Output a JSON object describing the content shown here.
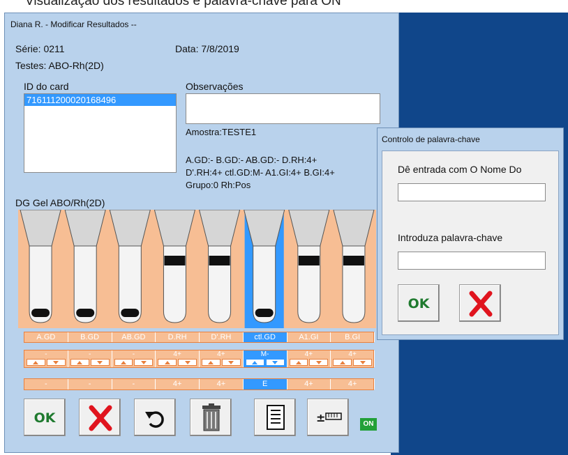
{
  "top_fragment": "Visualização dos resultados e palavra-chave para ON",
  "window": {
    "title": "Diana R. - Modificar Resultados --",
    "serie_label": "Série: 0211",
    "data_label": "Data: 7/8/2019",
    "testes_label": "Testes: ABO-Rh(2D)",
    "id_card_label": "ID do card",
    "id_card_items": [
      "716111200020168496"
    ],
    "observacoes_label": "Observações",
    "observacoes_value": "",
    "amostra": "Amostra:TESTE1",
    "result_line1": "A.GD:-  B.GD:-  AB.GD:-  D.RH:4+",
    "result_line2": "D'.RH:4+  ctl.GD:M-  A1.GI:4+  B.GI:4+",
    "result_line3": "Grupo:0  Rh:Pos",
    "gel_title": "DG Gel ABO/Rh(2D)"
  },
  "columns": [
    {
      "name": "A.GD",
      "reaction": "-",
      "final": "-",
      "selected": false,
      "band": "bottom"
    },
    {
      "name": "B.GD",
      "reaction": "-",
      "final": "-",
      "selected": false,
      "band": "bottom"
    },
    {
      "name": "AB.GD",
      "reaction": "-",
      "final": "-",
      "selected": false,
      "band": "bottom"
    },
    {
      "name": "D.RH",
      "reaction": "4+",
      "final": "4+",
      "selected": false,
      "band": "top"
    },
    {
      "name": "D'.RH",
      "reaction": "4+",
      "final": "4+",
      "selected": false,
      "band": "top"
    },
    {
      "name": "ctl.GD",
      "reaction": "M-",
      "final": "E",
      "selected": true,
      "band": "bottom"
    },
    {
      "name": "A1.GI",
      "reaction": "4+",
      "final": "4+",
      "selected": false,
      "band": "top"
    },
    {
      "name": "B.GI",
      "reaction": "4+",
      "final": "4+",
      "selected": false,
      "band": "top"
    }
  ],
  "toolbar": {
    "ok_label": "OK",
    "buttons": [
      "ok-icon",
      "cancel-icon",
      "undo-icon",
      "trash-icon",
      "report-icon",
      "adjust-icon"
    ],
    "on_badge": "ON"
  },
  "dialog": {
    "title": "Controlo de palavra-chave",
    "name_label": "Dê entrada com O Nome Do",
    "name_value": "",
    "password_label": "Introduza palavra-chave",
    "password_value": "",
    "ok_label": "OK"
  },
  "colors": {
    "accent": "#3399ff",
    "gel": "#f7be94",
    "desktop": "#10468a",
    "ok_green": "#1f7a2f",
    "cancel_red": "#e0141e"
  }
}
